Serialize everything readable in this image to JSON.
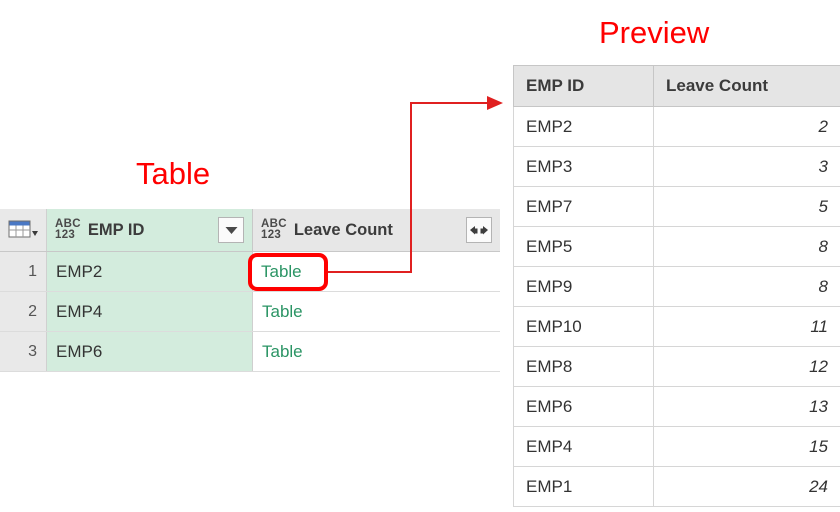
{
  "annotations": {
    "table_label": "Table",
    "preview_label": "Preview",
    "callout_color": "#ff0000",
    "callout_cell_text": "Table"
  },
  "query_table": {
    "corner_icon": "table-grid-dropdown-icon",
    "columns": [
      {
        "name": "EMP ID",
        "type_icon": "abc123",
        "type_icon_line1": "ABC",
        "type_icon_line2": "123",
        "selected": true,
        "highlight_color": "#d3ecdd",
        "filter_icon": "chevron-down-icon"
      },
      {
        "name": "Leave Count",
        "type_icon": "abc123",
        "type_icon_line1": "ABC",
        "type_icon_line2": "123",
        "selected": false,
        "highlight_color": "#e7e7e7",
        "expand_icon": "expand-columns-icon"
      }
    ],
    "rows": [
      {
        "num": "1",
        "emp_id": "EMP2",
        "leave_count": "Table"
      },
      {
        "num": "2",
        "emp_id": "EMP4",
        "leave_count": "Table"
      },
      {
        "num": "3",
        "emp_id": "EMP6",
        "leave_count": "Table"
      }
    ],
    "link_color": "#2a9464"
  },
  "preview_table": {
    "headers": [
      "EMP ID",
      "Leave Count"
    ],
    "rows": [
      {
        "emp_id": "EMP2",
        "leave_count": "2"
      },
      {
        "emp_id": "EMP3",
        "leave_count": "3"
      },
      {
        "emp_id": "EMP7",
        "leave_count": "5"
      },
      {
        "emp_id": "EMP5",
        "leave_count": "8"
      },
      {
        "emp_id": "EMP9",
        "leave_count": "8"
      },
      {
        "emp_id": "EMP10",
        "leave_count": "11"
      },
      {
        "emp_id": "EMP8",
        "leave_count": "12"
      },
      {
        "emp_id": "EMP6",
        "leave_count": "13"
      },
      {
        "emp_id": "EMP4",
        "leave_count": "15"
      },
      {
        "emp_id": "EMP1",
        "leave_count": "24"
      }
    ]
  }
}
